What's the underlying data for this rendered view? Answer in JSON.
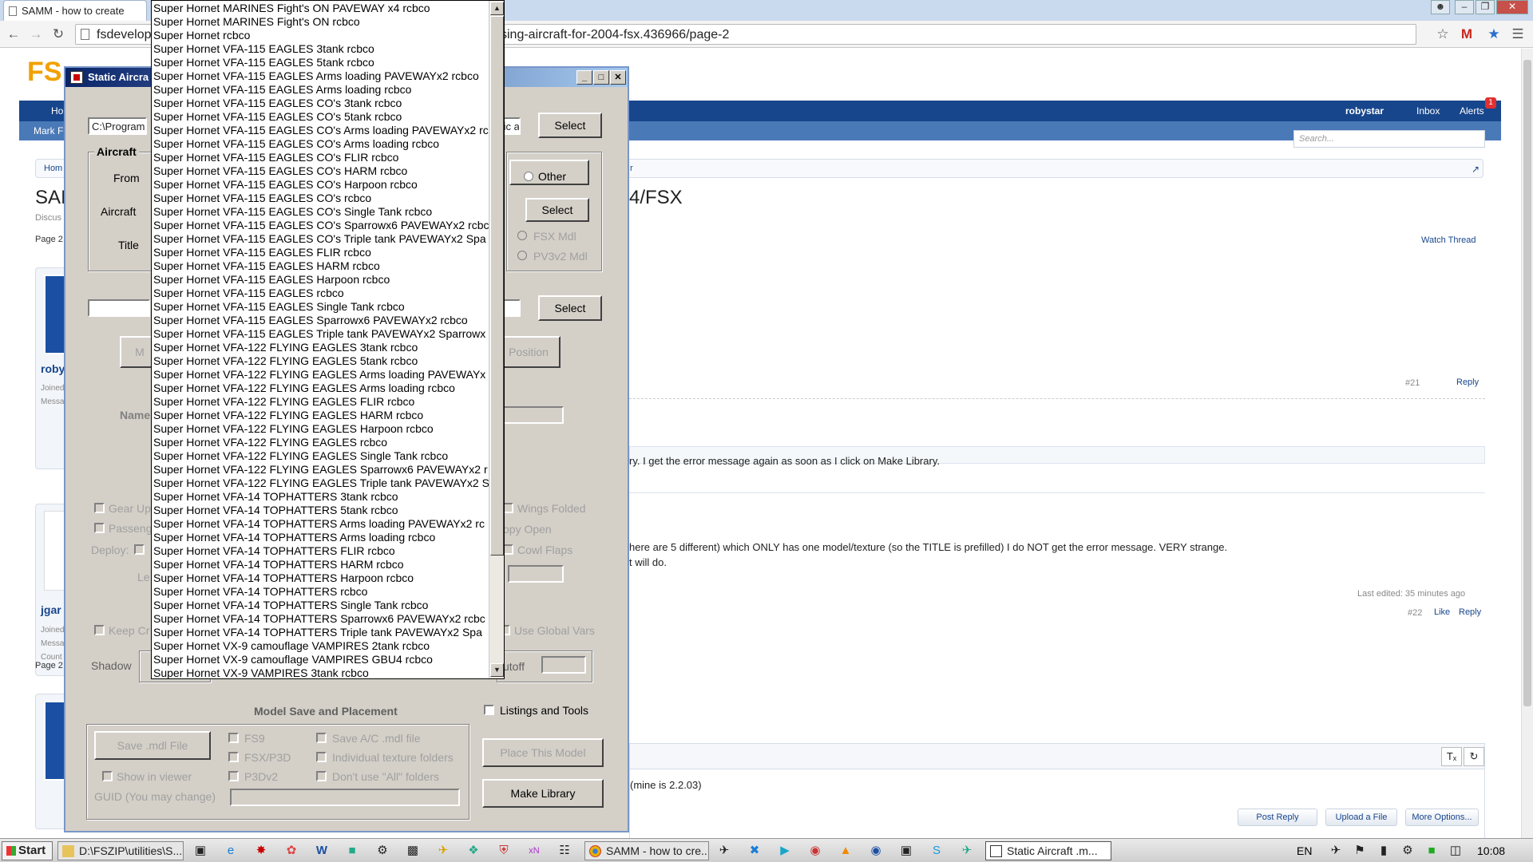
{
  "browser": {
    "tab_title": "SAMM - how to create",
    "url_left": "fsdevelop",
    "url_right": "sing-aircraft-for-2004-fsx.436966/page-2"
  },
  "forum": {
    "logo": "FS",
    "nav_left_partial": "Ho",
    "user": "robystar",
    "inbox": "Inbox",
    "alerts": "Alerts",
    "alerts_count": "1",
    "subnav_partial": "Mark F",
    "search_placeholder": "Search...",
    "breadcrumb_home": "Hom",
    "breadcrumb_tail": "r",
    "title_left": "SAI",
    "title_right": "4/FSX",
    "discussion_partial": "Discus",
    "page_label_top": "Page 2",
    "page_label_bottom": "Page 2",
    "watch_thread": "Watch Thread",
    "post21_num": "#21",
    "post21_reply": "Reply",
    "user1_name": "roby",
    "user1_joined": "Joined",
    "user1_messages": "Messa",
    "user2_name": "jgar",
    "user2_joined": "Joined",
    "user2_messages": "Messa",
    "user2_country": "Count",
    "post22_line1": "ry. I get the error message again as soon as I click on Make Library.",
    "post22_line2": "here are 5 different) which ONLY has one model/texture (so the TITLE is prefilled) I do NOT get the error message. VERY strange.",
    "post22_line3": "t will do.",
    "last_edited": "Last edited: 35 minutes ago",
    "post22_num": "#22",
    "like": "Like",
    "reply": "Reply",
    "editor_text": "(mine is 2.2.03)",
    "post_reply": "Post Reply",
    "upload_file": "Upload a File",
    "more_options": "More Options..."
  },
  "dialog": {
    "title": "Static Aircra",
    "path_value": "C:\\Program F",
    "path_right_value": "tic a",
    "select_label": "Select",
    "aircraft_group": "Aircraft",
    "from_label": "From",
    "aircraft_label": "Aircraft",
    "title_label": "Title",
    "other_label": "Other",
    "fsx_mdl": "FSX Mdl",
    "pv3v2_mdl": "PV3v2 Mdl",
    "position_label": "Position",
    "m_partial": "M",
    "name_label": "Name",
    "gear_up": "Gear Up",
    "passeng": "Passeng",
    "deploy": "Deploy:",
    "le_partial": "Le",
    "wings_folded": "Wings Folded",
    "canopy_open": "opy Open",
    "cowl_flaps": "Cowl Flaps",
    "keep_cr": "Keep Cr",
    "use_global_vars": "Use Global Vars",
    "shadow": "Shadow",
    "cutoff": "utoff",
    "model_save_title": "Model Save and Placement",
    "listings_and_tools": "Listings and Tools",
    "save_mdl": "Save .mdl File",
    "fs9": "FS9",
    "fsx_p3d": "FSX/P3D",
    "p3dv2": "P3Dv2",
    "save_ac_mdl": "Save A/C .mdl file",
    "individual_texture": "Individual texture folders",
    "dont_use_all": "Don't use \"All\" folders",
    "show_in_viewer": "Show in viewer",
    "guid_label": "GUID (You may change)",
    "place_this_model": "Place This Model",
    "make_library": "Make Library"
  },
  "dropdown_items": [
    "Super Hornet MARINES Fight's ON PAVEWAY x4 rcbco",
    "Super Hornet MARINES Fight's ON rcbco",
    "Super Hornet rcbco",
    "Super Hornet VFA-115 EAGLES 3tank rcbco",
    "Super Hornet VFA-115 EAGLES 5tank rcbco",
    "Super Hornet VFA-115 EAGLES Arms loading PAVEWAYx2 rcbco",
    "Super Hornet VFA-115 EAGLES Arms loading rcbco",
    "Super Hornet VFA-115 EAGLES CO's 3tank rcbco",
    "Super Hornet VFA-115 EAGLES CO's 5tank rcbco",
    "Super Hornet VFA-115 EAGLES CO's Arms loading PAVEWAYx2 rc",
    "Super Hornet VFA-115 EAGLES CO's Arms loading rcbco",
    "Super Hornet VFA-115 EAGLES CO's FLIR rcbco",
    "Super Hornet VFA-115 EAGLES CO's HARM rcbco",
    "Super Hornet VFA-115 EAGLES CO's Harpoon rcbco",
    "Super Hornet VFA-115 EAGLES CO's rcbco",
    "Super Hornet VFA-115 EAGLES CO's Single Tank rcbco",
    "Super Hornet VFA-115 EAGLES CO's Sparrowx6 PAVEWAYx2 rcbc",
    "Super Hornet VFA-115 EAGLES CO's Triple tank PAVEWAYx2 Spa",
    "Super Hornet VFA-115 EAGLES FLIR rcbco",
    "Super Hornet VFA-115 EAGLES HARM rcbco",
    "Super Hornet VFA-115 EAGLES Harpoon rcbco",
    "Super Hornet VFA-115 EAGLES rcbco",
    "Super Hornet VFA-115 EAGLES Single Tank rcbco",
    "Super Hornet VFA-115 EAGLES Sparrowx6 PAVEWAYx2 rcbco",
    "Super Hornet VFA-115 EAGLES Triple tank PAVEWAYx2 Sparrowx",
    "Super Hornet VFA-122 FLYING EAGLES 3tank rcbco",
    "Super Hornet VFA-122 FLYING EAGLES 5tank rcbco",
    "Super Hornet VFA-122 FLYING EAGLES Arms loading PAVEWAYx",
    "Super Hornet VFA-122 FLYING EAGLES Arms loading rcbco",
    "Super Hornet VFA-122 FLYING EAGLES FLIR rcbco",
    "Super Hornet VFA-122 FLYING EAGLES HARM rcbco",
    "Super Hornet VFA-122 FLYING EAGLES Harpoon rcbco",
    "Super Hornet VFA-122 FLYING EAGLES rcbco",
    "Super Hornet VFA-122 FLYING EAGLES Single Tank rcbco",
    "Super Hornet VFA-122 FLYING EAGLES Sparrowx6 PAVEWAYx2 r",
    "Super Hornet VFA-122 FLYING EAGLES Triple tank PAVEWAYx2 S",
    "Super Hornet VFA-14 TOPHATTERS 3tank rcbco",
    "Super Hornet VFA-14 TOPHATTERS 5tank rcbco",
    "Super Hornet VFA-14 TOPHATTERS Arms loading PAVEWAYx2 rc",
    "Super Hornet VFA-14 TOPHATTERS Arms loading rcbco",
    "Super Hornet VFA-14 TOPHATTERS FLIR rcbco",
    "Super Hornet VFA-14 TOPHATTERS HARM rcbco",
    "Super Hornet VFA-14 TOPHATTERS Harpoon rcbco",
    "Super Hornet VFA-14 TOPHATTERS rcbco",
    "Super Hornet VFA-14 TOPHATTERS Single Tank rcbco",
    "Super Hornet VFA-14 TOPHATTERS Sparrowx6 PAVEWAYx2 rcbc",
    "Super Hornet VFA-14 TOPHATTERS Triple tank PAVEWAYx2 Spa",
    "Super Hornet VX-9 camouflage VAMPIRES 2tank rcbco",
    "Super Hornet VX-9 camouflage VAMPIRES GBU4 rcbco",
    "Super Hornet VX-9 VAMPIRES 3tank rcbco"
  ],
  "taskbar": {
    "start": "Start",
    "task1": "D:\\FSZIP\\utilities\\S...",
    "task_chrome": "SAMM - how to cre...",
    "task_static": "Static Aircraft .m...",
    "lang": "EN",
    "clock": "10:08"
  }
}
